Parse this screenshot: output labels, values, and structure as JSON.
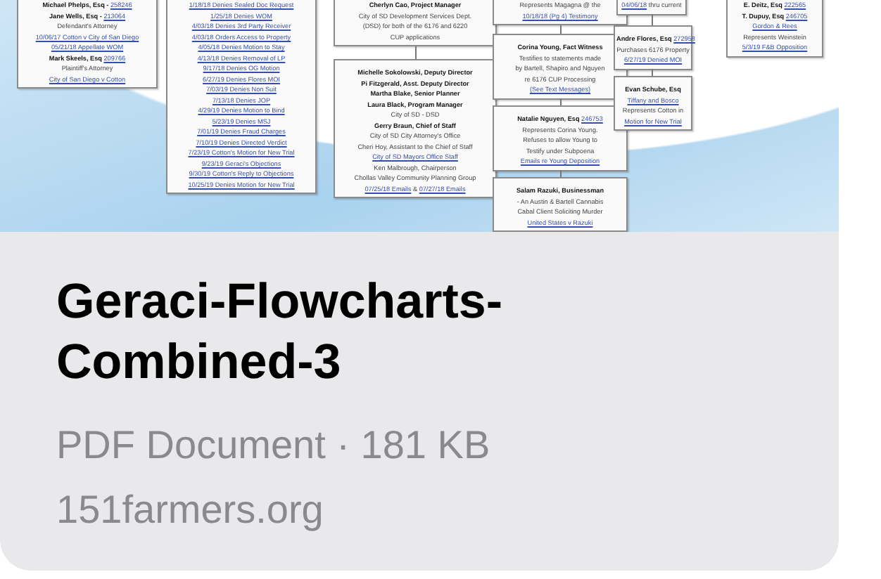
{
  "thumbnail": {
    "nodes": [
      {
        "lines": [
          {
            "parts": [
              {
                "kind": "bold",
                "text": "Michael Phelps, Esq - "
              },
              {
                "kind": "link",
                "text": "258246"
              }
            ]
          },
          {
            "parts": [
              {
                "kind": "bold",
                "text": "Jane Wells, Esq - "
              },
              {
                "kind": "link",
                "text": "213064"
              }
            ]
          },
          {
            "parts": [
              {
                "kind": "plain",
                "text": "Defendant's Attorney"
              }
            ]
          },
          {
            "parts": [
              {
                "kind": "link",
                "text": "10/06/17 Cotton v City of San Diego"
              }
            ]
          },
          {
            "parts": [
              {
                "kind": "link",
                "text": "05/21/18 Appellate WOM"
              }
            ]
          },
          {
            "parts": [
              {
                "kind": "bold",
                "text": "Mark Skeels, Esq "
              },
              {
                "kind": "link",
                "text": "209766"
              }
            ]
          },
          {
            "parts": [
              {
                "kind": "plain",
                "text": "Plaintiff's Attorney"
              }
            ]
          },
          {
            "parts": [
              {
                "kind": "link",
                "text": "City of San Diego v Cotton"
              }
            ]
          }
        ]
      },
      {
        "lines": [
          {
            "parts": [
              {
                "kind": "link",
                "text": "1/18/18 Denies Sealed Doc Request"
              }
            ]
          },
          {
            "parts": [
              {
                "kind": "link",
                "text": "1/25/18 Denies WOM"
              }
            ]
          },
          {
            "parts": [
              {
                "kind": "link",
                "text": "4/03/18 Denies 3rd Party Receiver"
              }
            ]
          },
          {
            "parts": [
              {
                "kind": "link",
                "text": "4/03/18 Orders Access to Property"
              }
            ]
          },
          {
            "parts": [
              {
                "kind": "link",
                "text": "4/05/18 Denies Motion to Stay"
              }
            ]
          },
          {
            "parts": [
              {
                "kind": "link",
                "text": "4/13/18 Denies Removal of LP"
              }
            ]
          },
          {
            "parts": [
              {
                "kind": "link",
                "text": "9/17/18 Denies OG Motion"
              }
            ]
          },
          {
            "parts": [
              {
                "kind": "link",
                "text": "6/27/19 Denies Flores MOI"
              }
            ]
          },
          {
            "parts": [
              {
                "kind": "link",
                "text": "7/03/19 Denies Non Suit"
              }
            ]
          },
          {
            "parts": [
              {
                "kind": "link",
                "text": "7/13/18 Denies JOP"
              }
            ]
          },
          {
            "parts": [
              {
                "kind": "link",
                "text": "4/29/19 Denies Motion to Bind"
              }
            ]
          },
          {
            "parts": [
              {
                "kind": "link",
                "text": "5/23/19 Denies MSJ"
              }
            ]
          },
          {
            "parts": [
              {
                "kind": "link",
                "text": "7/01/19 Denies Fraud Charges"
              }
            ]
          },
          {
            "parts": [
              {
                "kind": "link",
                "text": "7/10/19 Denies Directed Verdict"
              }
            ]
          },
          {
            "parts": [
              {
                "kind": "link",
                "text": "7/23/19 Cotton's Motion for New Trial"
              }
            ]
          },
          {
            "parts": [
              {
                "kind": "link",
                "text": "9/23/19 Geraci's Objections"
              }
            ]
          },
          {
            "parts": [
              {
                "kind": "link",
                "text": "9/30/19 Cotton's Reply to Objections"
              }
            ]
          },
          {
            "parts": [
              {
                "kind": "link",
                "text": "10/25/19 Denies Motion for New Trial"
              }
            ]
          }
        ]
      },
      {
        "lines": [
          {
            "parts": [
              {
                "kind": "bold",
                "text": "Cherlyn Cao, Project Manager"
              }
            ]
          },
          {
            "parts": [
              {
                "kind": "plain",
                "text": "City of SD Development Services Dept."
              }
            ]
          },
          {
            "parts": [
              {
                "kind": "plain",
                "text": "(DSD) for both of the 6176 and 6220"
              }
            ]
          },
          {
            "parts": [
              {
                "kind": "plain",
                "text": "CUP applications"
              }
            ]
          }
        ]
      },
      {
        "lines": [
          {
            "parts": [
              {
                "kind": "bold",
                "text": "Michelle Sokolowski, Deputy Director"
              }
            ]
          },
          {
            "parts": [
              {
                "kind": "bold",
                "text": "Pi Fitzgerald, Asst. Deputy Director"
              }
            ]
          },
          {
            "parts": [
              {
                "kind": "bold",
                "text": "Martha Blake, Senior Planner"
              }
            ]
          },
          {
            "parts": [
              {
                "kind": "bold",
                "text": "Laura Black, Program Manager"
              }
            ]
          },
          {
            "parts": [
              {
                "kind": "plain",
                "text": "City of SD - DSD"
              }
            ]
          },
          {
            "parts": [
              {
                "kind": "bold",
                "text": "Gerry Braun, Chief of Staff"
              }
            ]
          },
          {
            "parts": [
              {
                "kind": "plain",
                "text": "City of SD City Attorney's Office"
              }
            ]
          },
          {
            "parts": [
              {
                "kind": "plain",
                "text": "Cheri Hoy, Assistant to the Chief of Staff"
              }
            ]
          },
          {
            "parts": [
              {
                "kind": "link",
                "text": "City of SD Mayors Office Staff"
              }
            ]
          },
          {
            "parts": [
              {
                "kind": "plain",
                "text": "Ken Malbrough, Chairperson"
              }
            ]
          },
          {
            "parts": [
              {
                "kind": "plain",
                "text": "Chollas Valley Community Planning Group"
              }
            ]
          },
          {
            "parts": [
              {
                "kind": "link",
                "text": "07/25/18 Emails"
              },
              {
                "kind": "plain",
                "text": " & "
              },
              {
                "kind": "link",
                "text": "07/27/18 Emails"
              }
            ]
          }
        ]
      },
      {
        "lines": [
          {
            "parts": [
              {
                "kind": "plain",
                "text": "Represents Magagna @ the"
              }
            ]
          },
          {
            "parts": [
              {
                "kind": "link",
                "text": "10/18/18 (Pg 4) Testimony"
              }
            ]
          }
        ]
      },
      {
        "lines": [
          {
            "parts": [
              {
                "kind": "bold",
                "text": "Corina Young, Fact Witness"
              }
            ]
          },
          {
            "parts": [
              {
                "kind": "plain",
                "text": "Testifies to statements made"
              }
            ]
          },
          {
            "parts": [
              {
                "kind": "plain",
                "text": "by Bartell, Shapiro and Nguyen"
              }
            ]
          },
          {
            "parts": [
              {
                "kind": "plain",
                "text": "re 6176 CUP Processing"
              }
            ]
          },
          {
            "parts": [
              {
                "kind": "link",
                "text": "(See Text Messages)"
              }
            ]
          }
        ]
      },
      {
        "lines": [
          {
            "parts": [
              {
                "kind": "bold",
                "text": "Natalie Nguyen, Esq "
              },
              {
                "kind": "link",
                "text": "246753"
              }
            ]
          },
          {
            "parts": [
              {
                "kind": "plain",
                "text": "Represents Corina Young."
              }
            ]
          },
          {
            "parts": [
              {
                "kind": "plain",
                "text": "Refuses to allow Young to"
              }
            ]
          },
          {
            "parts": [
              {
                "kind": "plain",
                "text": "Testify under Subpoena"
              }
            ]
          },
          {
            "parts": [
              {
                "kind": "link",
                "text": "Emails re Young Deposition"
              }
            ]
          }
        ]
      },
      {
        "lines": [
          {
            "parts": [
              {
                "kind": "bold",
                "text": "Salam Razuki, Businessman"
              }
            ]
          },
          {
            "parts": [
              {
                "kind": "plain",
                "text": "- An Austin & Bartell Cannabis"
              }
            ]
          },
          {
            "parts": [
              {
                "kind": "plain",
                "text": "Cabal Client Soliciting Murder"
              }
            ]
          },
          {
            "parts": [
              {
                "kind": "link",
                "text": "United States v Razuki"
              }
            ]
          }
        ]
      },
      {
        "lines": [
          {
            "parts": [
              {
                "kind": "link",
                "text": "04/06/18"
              },
              {
                "kind": "plain",
                "text": " thru current"
              }
            ]
          }
        ]
      },
      {
        "lines": [
          {
            "parts": [
              {
                "kind": "bold",
                "text": "Andre Flores, Esq "
              },
              {
                "kind": "link",
                "text": "272958"
              }
            ]
          },
          {
            "parts": [
              {
                "kind": "plain",
                "text": "Purchases 6176 Property"
              }
            ]
          },
          {
            "parts": [
              {
                "kind": "link",
                "text": "6/27/19 Denied MOI"
              }
            ]
          }
        ]
      },
      {
        "lines": [
          {
            "parts": [
              {
                "kind": "bold",
                "text": "Evan Schube, Esq"
              }
            ]
          },
          {
            "parts": [
              {
                "kind": "link",
                "text": "Tiffany and Bosco"
              }
            ]
          },
          {
            "parts": [
              {
                "kind": "plain",
                "text": "Represents Cotton in"
              }
            ]
          },
          {
            "parts": [
              {
                "kind": "link",
                "text": "Motion for New Trial"
              }
            ]
          }
        ]
      },
      {
        "lines": [
          {
            "parts": [
              {
                "kind": "bold",
                "text": "E. Deitz, Esq "
              },
              {
                "kind": "link",
                "text": "222565"
              }
            ]
          },
          {
            "parts": [
              {
                "kind": "bold",
                "text": "T. Dupuy, Esq "
              },
              {
                "kind": "link",
                "text": "246705"
              }
            ]
          },
          {
            "parts": [
              {
                "kind": "link",
                "text": "Gordon & Rees"
              }
            ]
          },
          {
            "parts": [
              {
                "kind": "plain",
                "text": "Represents Weinstein"
              }
            ]
          },
          {
            "parts": [
              {
                "kind": "link",
                "text": "5/3/19 F&B Opposition"
              }
            ]
          }
        ]
      }
    ]
  },
  "title": "Geraci-Flowcharts-Combined-3",
  "subtitle": "PDF Document · 181 KB",
  "domain": "151farmers.org"
}
